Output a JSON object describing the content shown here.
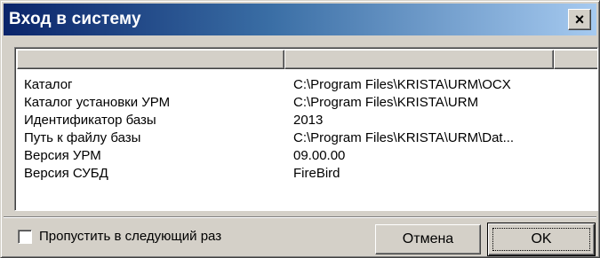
{
  "window": {
    "title": "Вход в систему",
    "close_glyph": "×"
  },
  "list": {
    "columns": [
      "",
      "",
      ""
    ],
    "rows": [
      {
        "name": "Каталог",
        "value": "C:\\Program Files\\KRISTA\\URM\\OCX"
      },
      {
        "name": "Каталог установки УРМ",
        "value": "C:\\Program Files\\KRISTA\\URM"
      },
      {
        "name": "Идентификатор базы",
        "value": "2013"
      },
      {
        "name": "Путь к файлу базы",
        "value": "C:\\Program Files\\KRISTA\\URM\\Dat..."
      },
      {
        "name": "Версия УРМ",
        "value": "09.00.00"
      },
      {
        "name": "Версия СУБД",
        "value": "FireBird"
      }
    ]
  },
  "footer": {
    "skip_checkbox_label": "Пропустить в следующий раз",
    "skip_checked": false,
    "cancel_label": "Отмена",
    "ok_label": "OK"
  }
}
